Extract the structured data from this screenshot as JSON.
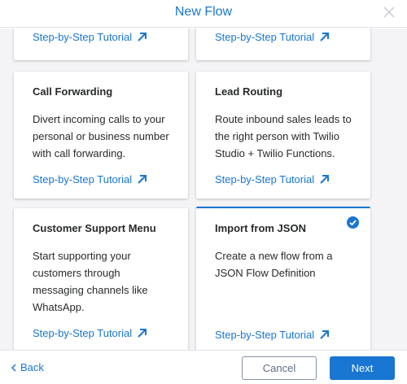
{
  "header": {
    "title": "New Flow"
  },
  "cards": [
    {
      "title": "",
      "description": "",
      "link": "Step-by-Step Tutorial"
    },
    {
      "title": "",
      "description": "",
      "link": "Step-by-Step Tutorial"
    },
    {
      "title": "Call Forwarding",
      "description": "Divert incoming calls to your personal or business number with call forwarding.",
      "link": "Step-by-Step Tutorial"
    },
    {
      "title": "Lead Routing",
      "description": "Route inbound sales leads to the right person with Twilio Studio + Twilio Functions.",
      "link": "Step-by-Step Tutorial"
    },
    {
      "title": "Customer Support Menu",
      "description": "Start supporting your customers through messaging channels like WhatsApp.",
      "link": "Step-by-Step Tutorial"
    },
    {
      "title": "Import from JSON",
      "description": "Create a new flow from a JSON Flow Definition",
      "link": "Step-by-Step Tutorial",
      "selected": true
    }
  ],
  "footer": {
    "back_label": "Back",
    "cancel_label": "Cancel",
    "next_label": "Next"
  },
  "colors": {
    "accent": "#1976d2",
    "background": "#f4f4f6"
  }
}
